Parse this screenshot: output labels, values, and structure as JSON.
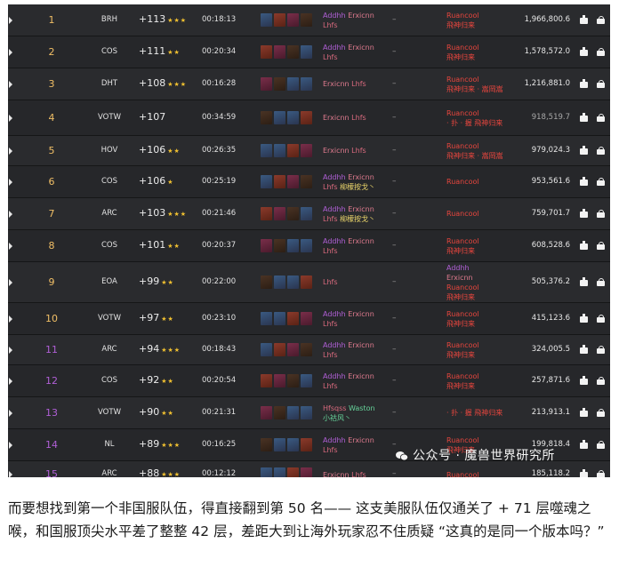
{
  "leaderboard": {
    "rows": [
      {
        "rank": "1",
        "dungeon": "BRH",
        "level": "+113",
        "stars": "★★★",
        "time": "00:18:13",
        "names": [
          [
            "Addhh",
            "c-dh"
          ],
          [
            "Erxicnn",
            "c-mage"
          ],
          [
            "Lhfs",
            "c-pink"
          ]
        ],
        "dash": "–",
        "guild": [
          [
            "Ruancool",
            "c-red"
          ],
          [
            "飛神归来",
            "c-red"
          ]
        ],
        "score": "1,966,800.6",
        "rank_color": "c-gold"
      },
      {
        "rank": "2",
        "dungeon": "COS",
        "level": "+111",
        "stars": "★★",
        "time": "00:20:34",
        "names": [
          [
            "Addhh",
            "c-dh"
          ],
          [
            "Erxicnn",
            "c-mage"
          ],
          [
            "Lhfs",
            "c-pink"
          ]
        ],
        "dash": "–",
        "guild": [
          [
            "Ruancool",
            "c-red"
          ],
          [
            "飛神归来",
            "c-red"
          ]
        ],
        "score": "1,578,572.0",
        "rank_color": "c-gold"
      },
      {
        "rank": "3",
        "dungeon": "DHT",
        "level": "+108",
        "stars": "★★★",
        "time": "00:16:28",
        "names": [
          [
            "Erxicnn",
            "c-mage"
          ],
          [
            "Lhfs",
            "c-pink"
          ]
        ],
        "dash": "–",
        "guild": [
          [
            "Ruancool",
            "c-red"
          ],
          [
            "飛神归来 · 嵩岡嵩",
            "c-red"
          ]
        ],
        "score": "1,216,881.0",
        "rank_color": "c-gold"
      },
      {
        "rank": "4",
        "dungeon": "VOTW",
        "level": "+107",
        "stars": "",
        "time": "00:34:59",
        "names": [
          [
            "Erxicnn",
            "c-mage"
          ],
          [
            "Lhfs",
            "c-pink"
          ]
        ],
        "dash": "–",
        "guild": [
          [
            "Ruancool",
            "c-red"
          ],
          [
            "· 扑 · 握 飛神归来",
            "c-red"
          ]
        ],
        "score": "918,519.7",
        "rank_color": "c-gold"
      },
      {
        "rank": "5",
        "dungeon": "HOV",
        "level": "+106",
        "stars": "★★",
        "time": "00:26:35",
        "names": [
          [
            "Erxicnn",
            "c-mage"
          ],
          [
            "Lhfs",
            "c-pink"
          ]
        ],
        "dash": "–",
        "guild": [
          [
            "Ruancool",
            "c-red"
          ],
          [
            "飛神归来 · 嵩岡嵩",
            "c-red"
          ]
        ],
        "score": "979,024.3",
        "rank_color": "c-gold"
      },
      {
        "rank": "6",
        "dungeon": "COS",
        "level": "+106",
        "stars": "★",
        "time": "00:25:19",
        "names": [
          [
            "Addhh",
            "c-dh"
          ],
          [
            "Erxicnn",
            "c-mage"
          ],
          [
            "Lhfs",
            "c-pink"
          ],
          [
            "柳檬按戈丶",
            "c-rogue"
          ]
        ],
        "dash": "–",
        "guild": [
          [
            "Ruancool",
            "c-red"
          ]
        ],
        "score": "953,561.6",
        "rank_color": "c-gold"
      },
      {
        "rank": "7",
        "dungeon": "ARC",
        "level": "+103",
        "stars": "★★★",
        "time": "00:21:46",
        "names": [
          [
            "Addhh",
            "c-dh"
          ],
          [
            "Erxicnn",
            "c-mage"
          ],
          [
            "Lhfs",
            "c-pink"
          ],
          [
            "柳檬按戈丶",
            "c-rogue"
          ]
        ],
        "dash": "–",
        "guild": [
          [
            "Ruancool",
            "c-red"
          ]
        ],
        "score": "759,701.7",
        "rank_color": "c-gold"
      },
      {
        "rank": "8",
        "dungeon": "COS",
        "level": "+101",
        "stars": "★★",
        "time": "00:20:37",
        "names": [
          [
            "Addhh",
            "c-dh"
          ],
          [
            "Erxicnn",
            "c-mage"
          ],
          [
            "Lhfs",
            "c-pink"
          ]
        ],
        "dash": "–",
        "guild": [
          [
            "Ruancool",
            "c-red"
          ],
          [
            "飛神归来",
            "c-red"
          ]
        ],
        "score": "608,528.6",
        "rank_color": "c-gold"
      },
      {
        "rank": "9",
        "dungeon": "EOA",
        "level": "+99",
        "stars": "★★",
        "time": "00:22:00",
        "names": [
          [
            "Lhfs",
            "c-pink"
          ]
        ],
        "dash": "–",
        "guild": [
          [
            "Addhh",
            "c-dh"
          ],
          [
            "Erxicnn",
            "c-mage"
          ],
          [
            "Ruancool",
            "c-red"
          ],
          [
            "飛神归来",
            "c-red"
          ]
        ],
        "score": "505,376.2",
        "rank_color": "c-gold"
      },
      {
        "rank": "10",
        "dungeon": "VOTW",
        "level": "+97",
        "stars": "★★",
        "time": "00:23:10",
        "names": [
          [
            "Addhh",
            "c-dh"
          ],
          [
            "Erxicnn",
            "c-mage"
          ],
          [
            "Lhfs",
            "c-pink"
          ]
        ],
        "dash": "–",
        "guild": [
          [
            "Ruancool",
            "c-red"
          ],
          [
            "飛神归来",
            "c-red"
          ]
        ],
        "score": "415,123.6",
        "rank_color": "c-gold"
      },
      {
        "rank": "11",
        "dungeon": "ARC",
        "level": "+94",
        "stars": "★★★",
        "time": "00:18:43",
        "names": [
          [
            "Addhh",
            "c-dh"
          ],
          [
            "Erxicnn",
            "c-mage"
          ],
          [
            "Lhfs",
            "c-pink"
          ]
        ],
        "dash": "–",
        "guild": [
          [
            "Ruancool",
            "c-red"
          ],
          [
            "飛神归来",
            "c-red"
          ]
        ],
        "score": "324,005.5",
        "rank_color": "c-dh"
      },
      {
        "rank": "12",
        "dungeon": "COS",
        "level": "+92",
        "stars": "★★",
        "time": "00:20:54",
        "names": [
          [
            "Addhh",
            "c-dh"
          ],
          [
            "Erxicnn",
            "c-mage"
          ],
          [
            "Lhfs",
            "c-pink"
          ]
        ],
        "dash": "–",
        "guild": [
          [
            "Ruancool",
            "c-red"
          ],
          [
            "飛神归来",
            "c-red"
          ]
        ],
        "score": "257,871.6",
        "rank_color": "c-dh"
      },
      {
        "rank": "13",
        "dungeon": "VOTW",
        "level": "+90",
        "stars": "★★",
        "time": "00:21:31",
        "names": [
          [
            "Hfsqss",
            "c-pink"
          ],
          [
            "Waston",
            "c-monk"
          ],
          [
            "小祜风丶",
            "c-monk"
          ]
        ],
        "dash": "–",
        "guild": [
          [
            "· 扑 · 握 飛神归来",
            "c-red"
          ]
        ],
        "score": "213,913.1",
        "rank_color": "c-dh"
      },
      {
        "rank": "14",
        "dungeon": "NL",
        "level": "+89",
        "stars": "★★★",
        "time": "00:16:25",
        "names": [
          [
            "Addhh",
            "c-dh"
          ],
          [
            "Erxicnn",
            "c-mage"
          ],
          [
            "Lhfs",
            "c-pink"
          ]
        ],
        "dash": "–",
        "guild": [
          [
            "Ruancool",
            "c-red"
          ],
          [
            "飛神归来",
            "c-red"
          ]
        ],
        "score": "199,818.4",
        "rank_color": "c-dh"
      },
      {
        "rank": "15",
        "dungeon": "ARC",
        "level": "+88",
        "stars": "★★★",
        "time": "00:12:12",
        "names": [
          [
            "Erxicnn",
            "c-mage"
          ],
          [
            "Lhfs",
            "c-pink"
          ]
        ],
        "dash": "–",
        "guild": [
          [
            "Ruancool",
            "c-red"
          ]
        ],
        "score": "185,118.2",
        "rank_color": "c-dh"
      }
    ],
    "watermark": "公众号 · 魔兽世界研究所"
  },
  "caption": "而要想找到第一个非国服队伍，得直接翻到第 50 名—— 这支美服队伍仅通关了 + 71 层噬魂之喉，和国服顶尖水平差了整整 42 层，差距大到让海外玩家忍不住质疑 “这真的是同一个版本吗？”",
  "colors": {
    "panel": "#1b1c1e",
    "row": "#2a2b2e",
    "gold": "#f1bf66",
    "purple": "#b05fd6",
    "red": "#e8463e"
  },
  "icons": [
    "expand-arrow-icon",
    "class-spec-icon",
    "video-icon",
    "overview-icon",
    "wechat-icon"
  ]
}
